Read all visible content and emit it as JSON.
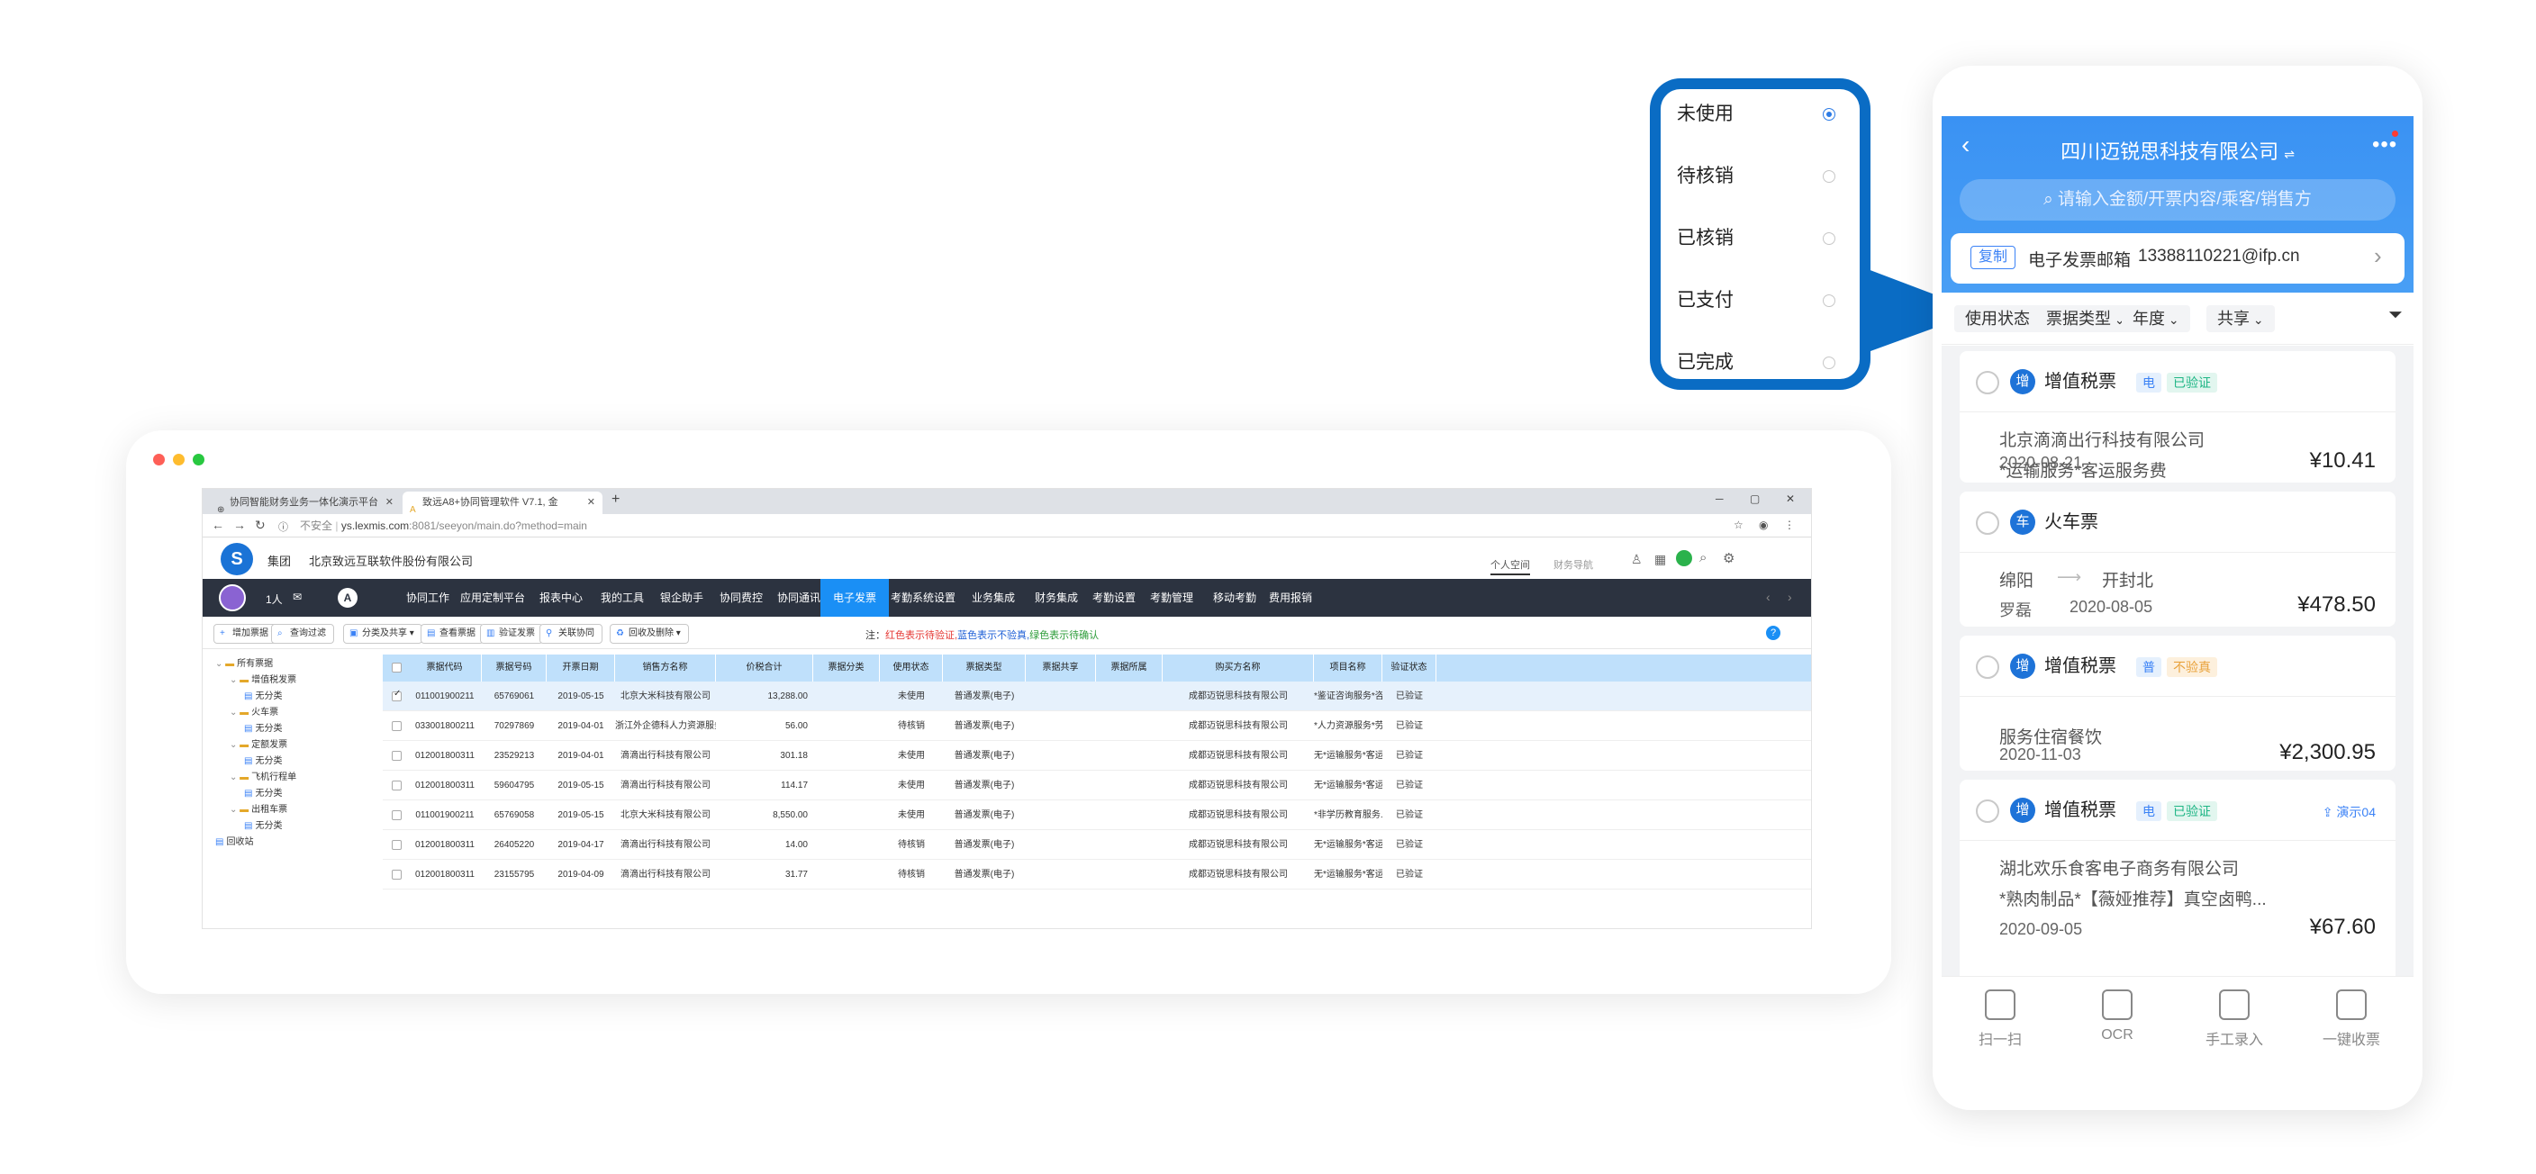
{
  "desktop": {
    "browser": {
      "tabs": [
        {
          "title": "协同智能财务业务一体化演示平台",
          "icon": "globe-icon"
        },
        {
          "title": "致远A8+协同管理软件 V7.1, 金",
          "icon": "page-icon"
        }
      ],
      "new_tab": "+",
      "window_controls": {
        "minimize": "─",
        "maximize": "▢",
        "close": "✕"
      },
      "address": {
        "insecure": "不安全",
        "host": "ys.lexmis.com",
        "path": ":8081/seeyon/main.do?method=main"
      }
    },
    "app": {
      "group_label": "集团",
      "company": "北京致远互联软件股份有限公司",
      "links": [
        "个人空间",
        "财务导航"
      ],
      "user_count": "1人",
      "nav_items": [
        "协同工作",
        "应用定制平台",
        "报表中心",
        "我的工具",
        "银企助手",
        "协同费控",
        "协同通讯",
        "电子发票",
        "考勤系统设置",
        "业务集成",
        "财务集成",
        "考勤设置",
        "考勤管理",
        "移动考勤",
        "费用报销"
      ],
      "active_nav": "电子发票",
      "toolbar": [
        "增加票据",
        "查询过滤",
        "分类及共享",
        "查看票据",
        "验证发票",
        "关联协同",
        "回收及删除"
      ],
      "note_prefix": "注：",
      "note_red": "红色表示待验证,",
      "note_blue": "蓝色表示不验真,",
      "note_green": "绿色表示待确认",
      "help": "?",
      "tree": [
        {
          "label": "所有票据",
          "level": 0,
          "type": "folder"
        },
        {
          "label": "增值税发票",
          "level": 1,
          "type": "folder"
        },
        {
          "label": "无分类",
          "level": 2,
          "type": "file"
        },
        {
          "label": "火车票",
          "level": 1,
          "type": "folder"
        },
        {
          "label": "无分类",
          "level": 2,
          "type": "file"
        },
        {
          "label": "定额发票",
          "level": 1,
          "type": "folder"
        },
        {
          "label": "无分类",
          "level": 2,
          "type": "file"
        },
        {
          "label": "飞机行程单",
          "level": 1,
          "type": "folder"
        },
        {
          "label": "无分类",
          "level": 2,
          "type": "file"
        },
        {
          "label": "出租车票",
          "level": 1,
          "type": "folder"
        },
        {
          "label": "无分类",
          "level": 2,
          "type": "file"
        },
        {
          "label": "回收站",
          "level": 0,
          "type": "file"
        }
      ],
      "columns": [
        "票据代码",
        "票据号码",
        "开票日期",
        "销售方名称",
        "价税合计",
        "票据分类",
        "使用状态",
        "票据类型",
        "票据共享",
        "票据所属",
        "购买方名称",
        "项目名称",
        "验证状态"
      ],
      "rows": [
        [
          "011001900211",
          "65769061",
          "2019-05-15",
          "北京大米科技有限公司",
          "13,288.00",
          "",
          "未使用",
          "普通发票(电子)",
          "",
          "",
          "成都迈锐思科技有限公司",
          "*鉴证咨询服务*咨...",
          "已验证"
        ],
        [
          "033001800211",
          "70297869",
          "2019-04-01",
          "浙江外企德科人力资源服务...",
          "56.00",
          "",
          "待核销",
          "普通发票(电子)",
          "",
          "",
          "成都迈锐思科技有限公司",
          "*人力资源服务*劳...",
          "已验证"
        ],
        [
          "012001800311",
          "23529213",
          "2019-04-01",
          "滴滴出行科技有限公司",
          "301.18",
          "",
          "未使用",
          "普通发票(电子)",
          "",
          "",
          "成都迈锐思科技有限公司",
          "无*运输服务*客运...",
          "已验证"
        ],
        [
          "012001800311",
          "59604795",
          "2019-05-15",
          "滴滴出行科技有限公司",
          "114.17",
          "",
          "未使用",
          "普通发票(电子)",
          "",
          "",
          "成都迈锐思科技有限公司",
          "无*运输服务*客运...",
          "已验证"
        ],
        [
          "011001900211",
          "65769058",
          "2019-05-15",
          "北京大米科技有限公司",
          "8,550.00",
          "",
          "未使用",
          "普通发票(电子)",
          "",
          "",
          "成都迈锐思科技有限公司",
          "*非学历教育服务...",
          "已验证"
        ],
        [
          "012001800311",
          "26405220",
          "2019-04-17",
          "滴滴出行科技有限公司",
          "14.00",
          "",
          "待核销",
          "普通发票(电子)",
          "",
          "",
          "成都迈锐思科技有限公司",
          "无*运输服务*客运...",
          "已验证"
        ],
        [
          "012001800311",
          "23155795",
          "2019-04-09",
          "滴滴出行科技有限公司",
          "31.77",
          "",
          "待核销",
          "普通发票(电子)",
          "",
          "",
          "成都迈锐思科技有限公司",
          "无*运输服务*客运...",
          "已验证"
        ]
      ]
    }
  },
  "popup": {
    "options": [
      "未使用",
      "待核销",
      "已核销",
      "已支付",
      "已完成"
    ],
    "selected_index": 0
  },
  "phone": {
    "title": "四川迈锐思科技有限公司",
    "search_placeholder": "请输入金额/开票内容/乘客/销售方",
    "email_copy": "复制",
    "email_label": "电子发票邮箱",
    "email_value": "13388110221@ifp.cn",
    "filters": [
      "使用状态",
      "票据类型",
      "年度",
      "共享"
    ],
    "cards": [
      {
        "type": "增值税票",
        "icon_char": "增",
        "badges": [
          {
            "text": "电",
            "style": "blue"
          },
          {
            "text": "已验证",
            "style": "green"
          }
        ],
        "lines": [
          "北京滴滴出行科技有限公司",
          "*运输服务*客运服务费"
        ],
        "date": "2020-08-21",
        "amount": "¥10.41"
      },
      {
        "type": "火车票",
        "icon_char": "车",
        "badges": [],
        "from": "绵阳",
        "to": "开封北",
        "passenger": "罗磊",
        "date": "2020-08-05",
        "amount": "¥478.50"
      },
      {
        "type": "增值税票",
        "icon_char": "增",
        "badges": [
          {
            "text": "普",
            "style": "blue"
          },
          {
            "text": "不验真",
            "style": "orange"
          }
        ],
        "lines": [
          "服务住宿餐饮"
        ],
        "date": "2020-11-03",
        "amount": "¥2,300.95"
      },
      {
        "type": "增值税票",
        "icon_char": "增",
        "badges": [
          {
            "text": "电",
            "style": "blue"
          },
          {
            "text": "已验证",
            "style": "green"
          }
        ],
        "share": "演示04",
        "lines": [
          "湖北欢乐食客电子商务有限公司",
          "*熟肉制品*【薇娅推荐】真空卤鸭..."
        ],
        "date": "2020-09-05",
        "amount": "¥67.60"
      }
    ],
    "bottom_bar": [
      "扫一扫",
      "OCR",
      "手工录入",
      "一键收票"
    ],
    "colors": {
      "header": "#3a92f3",
      "accent": "#1e73d8"
    }
  }
}
